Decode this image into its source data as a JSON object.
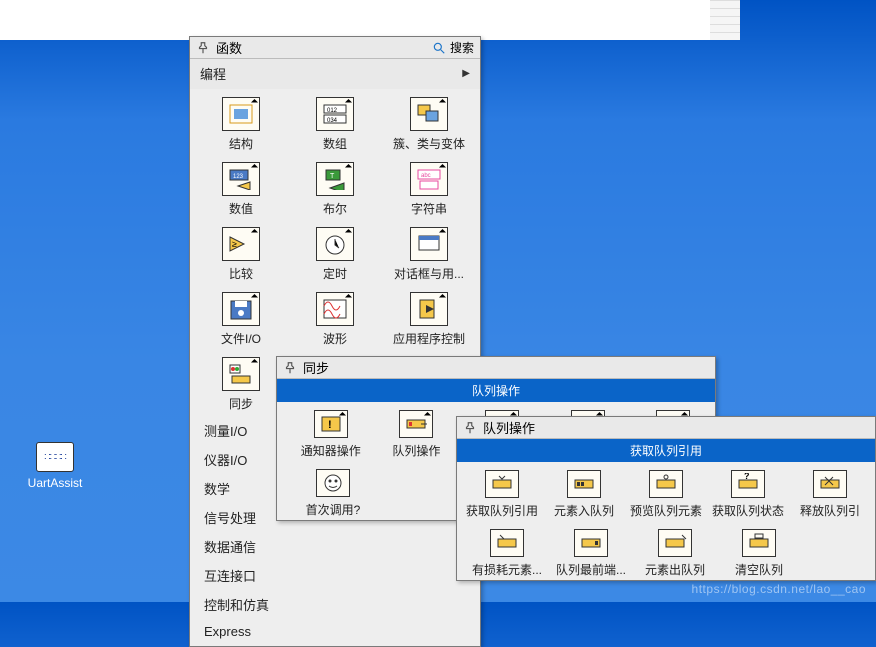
{
  "desktop": {
    "uartassist_label": "UartAssist"
  },
  "main": {
    "title": "函数",
    "search": "搜索",
    "section_programming": "编程",
    "grid": [
      {
        "l0": "结构",
        "l1": "数组",
        "l2": "簇、类与变体"
      },
      {
        "l0": "数值",
        "l1": "布尔",
        "l2": "字符串"
      },
      {
        "l0": "比较",
        "l1": "定时",
        "l2": "对话框与用..."
      },
      {
        "l0": "文件I/O",
        "l1": "波形",
        "l2": "应用程序控制"
      },
      {
        "l0": "同步",
        "l1": "",
        "l2": ""
      }
    ],
    "cats": [
      "测量I/O",
      "仪器I/O",
      "数学",
      "信号处理",
      "数据通信",
      "互连接口",
      "控制和仿真",
      "Express"
    ]
  },
  "sync": {
    "title": "同步",
    "banner": "队列操作",
    "row": {
      "l0": "通知器操作",
      "l1": "队列操作"
    },
    "firstcall": "首次调用?"
  },
  "queue": {
    "title": "队列操作",
    "banner": "获取队列引用",
    "row1": {
      "l0": "获取队列引用",
      "l1": "元素入队列",
      "l2": "预览队列元素",
      "l3": "获取队列状态",
      "l4": "释放队列引"
    },
    "row2": {
      "l0": "有损耗元素...",
      "l1": "队列最前端...",
      "l2": "元素出队列",
      "l3": "清空队列"
    }
  },
  "watermark": "https://blog.csdn.net/lao__cao"
}
